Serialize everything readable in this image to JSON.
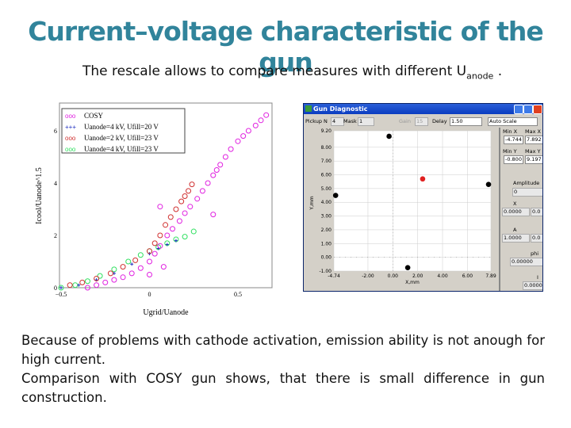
{
  "title": "Current–voltage characteristic of the gun",
  "subtitle": {
    "text": "The rescale allows to compare measures with different U",
    "subscript": "anode",
    "suffix": " ."
  },
  "body": [
    "Because of problems with cathode activation, emission ability is not anough for high current.",
    "Comparison with COSY gun shows, that there is small difference in gun construction."
  ],
  "chart_data": [
    {
      "type": "scatter",
      "xlabel": "Ugrid/Uanode",
      "ylabel": "Icool/Uanode^1.5",
      "xlim": [
        -0.5,
        0.72
      ],
      "ylim": [
        0,
        7
      ],
      "xticks": [
        "−0.5",
        "0",
        "0.5"
      ],
      "xtick_values": [
        -0.5,
        0,
        0.5
      ],
      "yticks": [
        "0",
        "2",
        "4",
        "6"
      ],
      "ytick_values": [
        0,
        2,
        4,
        6
      ],
      "legend": "top-left",
      "series": [
        {
          "name": "COSY",
          "color": "#e020e0",
          "marker": "o",
          "x": [
            -0.35,
            -0.3,
            -0.25,
            -0.2,
            -0.15,
            -0.1,
            -0.05,
            0,
            0.03,
            0.06,
            0.1,
            0.13,
            0.17,
            0.2,
            0.23,
            0.27,
            0.3,
            0.33,
            0.36,
            0.4,
            0.43,
            0.46,
            0.5,
            0.53,
            0.56,
            0.6,
            0.63,
            0.66,
            0.06,
            0,
            0.08,
            0.36,
            0.38
          ],
          "y": [
            0,
            0.1,
            0.2,
            0.3,
            0.4,
            0.55,
            0.75,
            1.0,
            1.3,
            1.6,
            2.0,
            2.25,
            2.55,
            2.85,
            3.1,
            3.4,
            3.7,
            4.0,
            4.3,
            4.7,
            5.0,
            5.3,
            5.6,
            5.8,
            6.0,
            6.2,
            6.4,
            6.6,
            3.1,
            0.5,
            0.8,
            2.8,
            4.5
          ]
        },
        {
          "name": "Uanode=4 kV, Ufill=20 V",
          "color": "#2030c0",
          "marker": "+",
          "x": [
            -0.5,
            -0.4,
            -0.3,
            -0.2,
            -0.1,
            0,
            0.05,
            0.1,
            0.15
          ],
          "y": [
            0,
            0.1,
            0.3,
            0.55,
            0.9,
            1.3,
            1.5,
            1.65,
            1.8
          ]
        },
        {
          "name": "Uanode=2 kV, Ufill=23 V",
          "color": "#d03030",
          "marker": "o",
          "x": [
            -0.45,
            -0.38,
            -0.3,
            -0.22,
            -0.15,
            -0.08,
            0,
            0.03,
            0.06,
            0.09,
            0.12,
            0.15,
            0.18,
            0.2,
            0.22,
            0.24
          ],
          "y": [
            0.1,
            0.2,
            0.35,
            0.55,
            0.8,
            1.05,
            1.4,
            1.7,
            2.0,
            2.4,
            2.7,
            3.0,
            3.3,
            3.5,
            3.7,
            3.95
          ]
        },
        {
          "name": "Uanode=4 kV, Ufill=23 V",
          "color": "#30e060",
          "marker": "o",
          "x": [
            -0.5,
            -0.42,
            -0.35,
            -0.28,
            -0.2,
            -0.12,
            -0.05,
            0,
            0.05,
            0.1,
            0.15,
            0.2,
            0.25
          ],
          "y": [
            0,
            0.1,
            0.25,
            0.45,
            0.7,
            1.0,
            1.25,
            1.4,
            1.55,
            1.7,
            1.85,
            1.95,
            2.15
          ]
        }
      ]
    },
    {
      "type": "scatter",
      "xlabel": "X,mm",
      "ylabel": "Y,mm",
      "xlim": [
        -4.74,
        7.89
      ],
      "ylim": [
        -1.0,
        9.2
      ],
      "xticks": [
        "-4.74",
        "-2.00",
        "0.00",
        "2.00",
        "4.00",
        "6.00",
        "7.89"
      ],
      "xtick_values": [
        -4.74,
        -2,
        0,
        2,
        4,
        6,
        7.89
      ],
      "yticks": [
        "-1.00",
        "0.00",
        "1.00",
        "2.00",
        "3.00",
        "4.00",
        "5.00",
        "6.00",
        "7.00",
        "8.00",
        "9.20"
      ],
      "ytick_values": [
        -1,
        0,
        1,
        2,
        3,
        4,
        5,
        6,
        7,
        8,
        9.2
      ],
      "series": [
        {
          "color": "#000000",
          "x": [
            -4.6,
            -0.3,
            1.2,
            7.7
          ],
          "y": [
            4.5,
            8.8,
            -0.75,
            5.3
          ]
        },
        {
          "color": "#e02020",
          "x": [
            2.4
          ],
          "y": [
            5.7
          ]
        }
      ]
    }
  ],
  "window": {
    "title": "Gun Diagnostic",
    "pickup_label": "Pickup N",
    "pickup": "4",
    "mask_label": "Mask",
    "mask": "1",
    "gain_label": "Gain",
    "gain": "15",
    "delay_label": "Delay",
    "delay": "1.50",
    "scale": "Auto Scale",
    "min_x_label": "Min X",
    "max_x_label": "Max X",
    "min_x": "-4.744",
    "max_x": "7.892",
    "min_y_label": "Min Y",
    "max_y_label": "Max Y",
    "min_y": "-0.800",
    "max_y": "9.197",
    "amplitude_label": "Amplitude",
    "amplitude": "0",
    "x_label": "X",
    "x1": "0.0000",
    "x2": "0.0",
    "a_label": "A",
    "a1": "1.0000",
    "a2": "0.0",
    "phi_label": "phi",
    "phi": "0.00000",
    "i_label": "I",
    "i": "0.0000"
  }
}
